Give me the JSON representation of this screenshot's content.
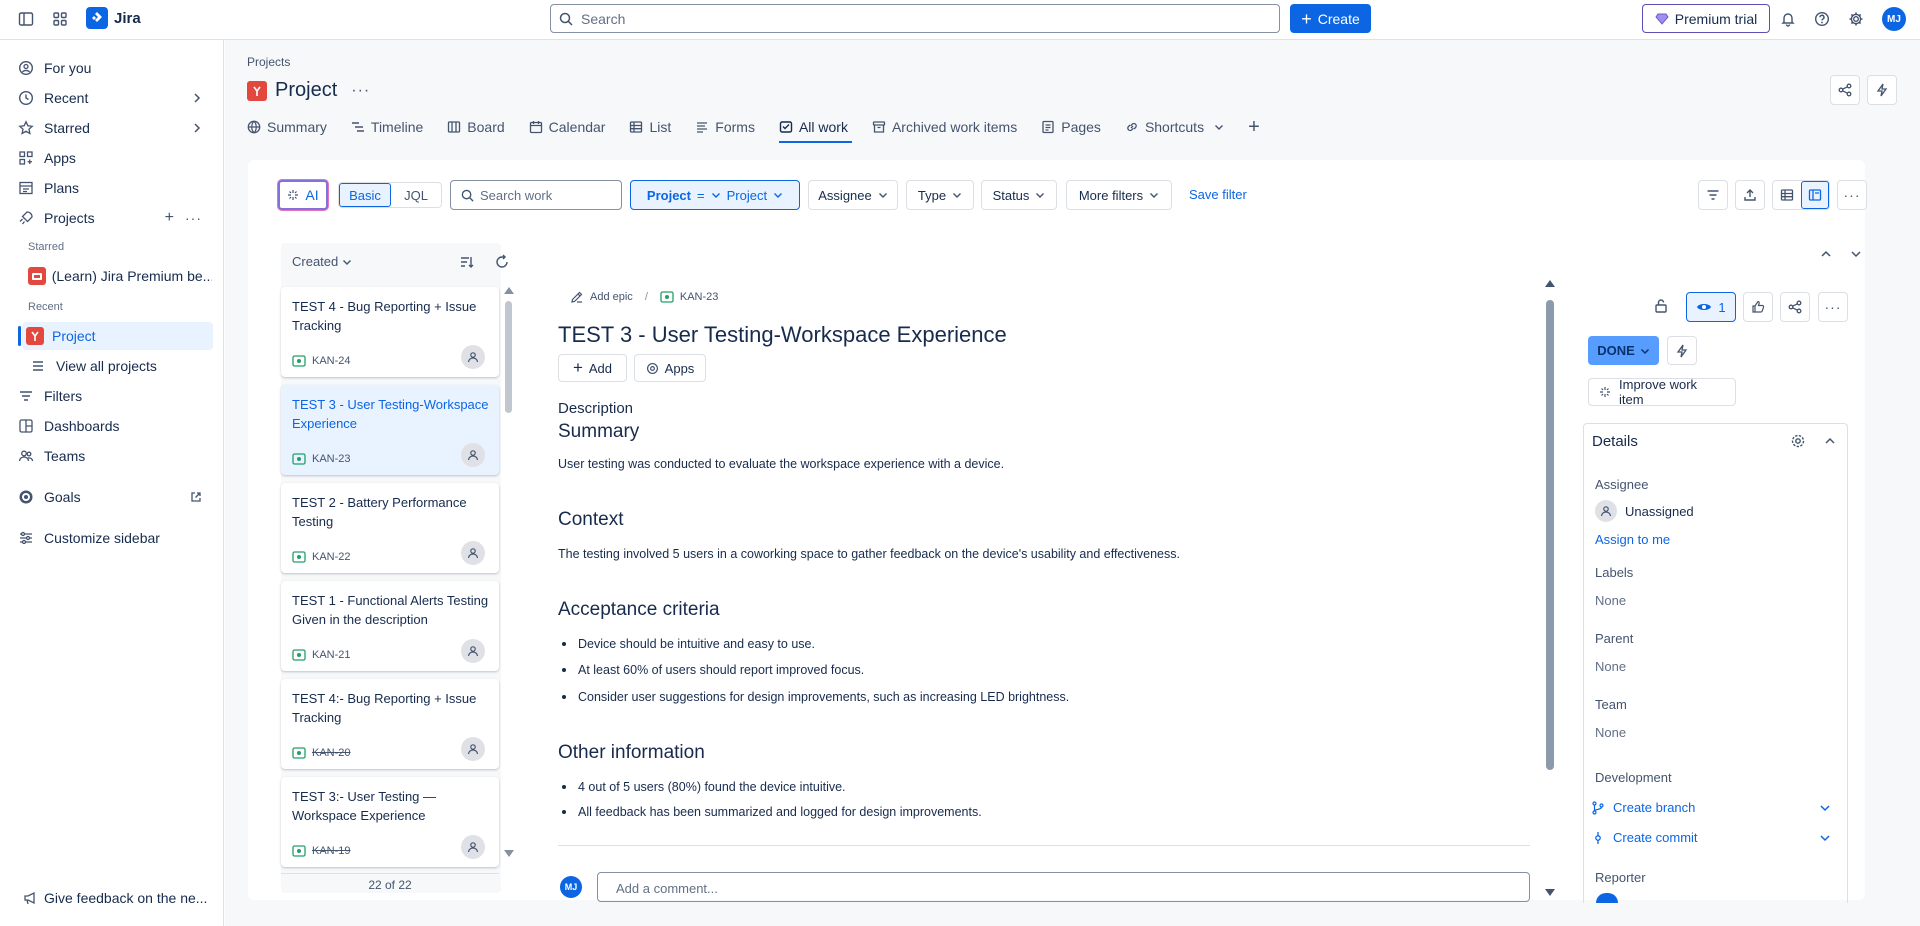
{
  "topbar": {
    "app_name": "Jira",
    "search_placeholder": "Search",
    "create_label": "Create",
    "premium_label": "Premium trial",
    "avatar_initials": "MJ"
  },
  "sidebar": {
    "items": {
      "for_you": "For you",
      "recent": "Recent",
      "starred": "Starred",
      "apps": "Apps",
      "plans": "Plans",
      "projects": "Projects",
      "starred_label": "Starred",
      "starred_project": "(Learn) Jira Premium be...",
      "recent_label": "Recent",
      "recent_project": "Project",
      "view_all_projects": "View all projects",
      "filters": "Filters",
      "dashboards": "Dashboards",
      "teams": "Teams",
      "goals": "Goals",
      "customize": "Customize sidebar"
    },
    "feedback": "Give feedback on the ne..."
  },
  "header": {
    "breadcrumb": "Projects",
    "title": "Project",
    "tabs": [
      "Summary",
      "Timeline",
      "Board",
      "Calendar",
      "List",
      "Forms",
      "All work",
      "Archived work items",
      "Pages",
      "Shortcuts"
    ]
  },
  "filters": {
    "ai": "AI",
    "basic": "Basic",
    "jql": "JQL",
    "search_placeholder": "Search work",
    "project_label": "Project",
    "project_op": "=",
    "project_value": "Project",
    "assignee": "Assignee",
    "type": "Type",
    "status": "Status",
    "more_filters": "More filters",
    "save_filter": "Save filter"
  },
  "list": {
    "sort_label": "Created",
    "count": "22 of 22",
    "items": [
      {
        "title": "TEST 4 - Bug Reporting + Issue Tracking",
        "key": "KAN-24",
        "done": false
      },
      {
        "title": "TEST 3 - User Testing-Workspace Experience",
        "key": "KAN-23",
        "done": false
      },
      {
        "title": "TEST 2 - Battery Performance Testing",
        "key": "KAN-22",
        "done": false
      },
      {
        "title": "TEST 1 - Functional Alerts Testing Given in the description",
        "key": "KAN-21",
        "done": false
      },
      {
        "title": "TEST 4:- Bug Reporting + Issue Tracking",
        "key": "KAN-20",
        "done": true
      },
      {
        "title": "TEST 3:- User Testing — Workspace Experience",
        "key": "KAN-19",
        "done": true
      }
    ]
  },
  "detail": {
    "add_epic": "Add epic",
    "key": "KAN-23",
    "title": "TEST 3 - User Testing-Workspace Experience",
    "add_label": "Add",
    "apps_label": "Apps",
    "description_label": "Description",
    "summary_heading": "Summary",
    "summary_text": "User testing was conducted to evaluate the workspace experience with a device.",
    "context_heading": "Context",
    "context_text": "The testing involved 5 users in a coworking space to gather feedback on the device's usability and effectiveness.",
    "acceptance_heading": "Acceptance criteria",
    "acceptance_items": [
      "Device should be intuitive and easy to use.",
      "At least 60% of users should report improved focus.",
      "Consider user suggestions for design improvements, such as increasing LED brightness."
    ],
    "other_heading": "Other information",
    "other_items": [
      "4 out of 5 users (80%) found the device intuitive.",
      "All feedback has been summarized and logged for design improvements."
    ],
    "comment_placeholder": "Add a comment...",
    "comment_avatar": "MJ"
  },
  "right_panel": {
    "watch_count": "1",
    "status": "DONE",
    "improve": "Improve work item",
    "details_title": "Details",
    "assignee_label": "Assignee",
    "assignee_value": "Unassigned",
    "assign_to_me": "Assign to me",
    "labels_label": "Labels",
    "labels_value": "None",
    "parent_label": "Parent",
    "parent_value": "None",
    "team_label": "Team",
    "team_value": "None",
    "development_label": "Development",
    "create_branch": "Create branch",
    "create_commit": "Create commit",
    "reporter_label": "Reporter"
  },
  "colors": {
    "brand": "#0c66e4",
    "done_status": "#579dff",
    "project_tile": "#e2483d",
    "premium": "#5e4db2"
  }
}
